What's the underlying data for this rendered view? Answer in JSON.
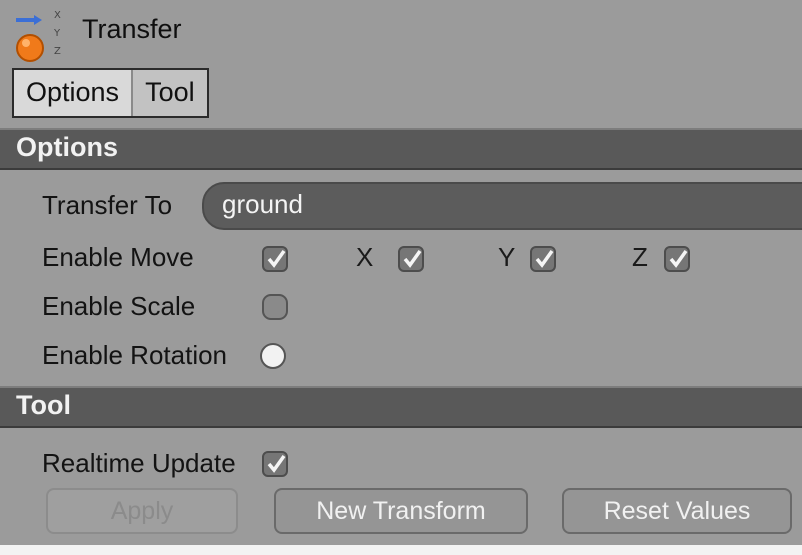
{
  "window": {
    "title": "Transfer",
    "icon": "transfer-tool-icon"
  },
  "tabs": [
    {
      "label": "Options",
      "active": true
    },
    {
      "label": "Tool",
      "active": false
    }
  ],
  "sections": {
    "options_header": "Options",
    "tool_header": "Tool"
  },
  "options": {
    "transfer_to_label": "Transfer To",
    "transfer_to_value": "ground",
    "enable_move_label": "Enable Move",
    "enable_move_checked": true,
    "x_label": "X",
    "x_checked": true,
    "y_label": "Y",
    "y_checked": true,
    "z_label": "Z",
    "z_checked": true,
    "enable_scale_label": "Enable Scale",
    "enable_scale_checked": false,
    "enable_rotation_label": "Enable Rotation",
    "enable_rotation_checked": false
  },
  "tool": {
    "realtime_update_label": "Realtime Update",
    "realtime_update_checked": true,
    "apply_label": "Apply",
    "new_transform_label": "New Transform",
    "reset_values_label": "Reset Values"
  },
  "colors": {
    "panel_bg": "#9b9b9b",
    "section_bg": "#595959",
    "field_bg": "#5c5c5c"
  }
}
